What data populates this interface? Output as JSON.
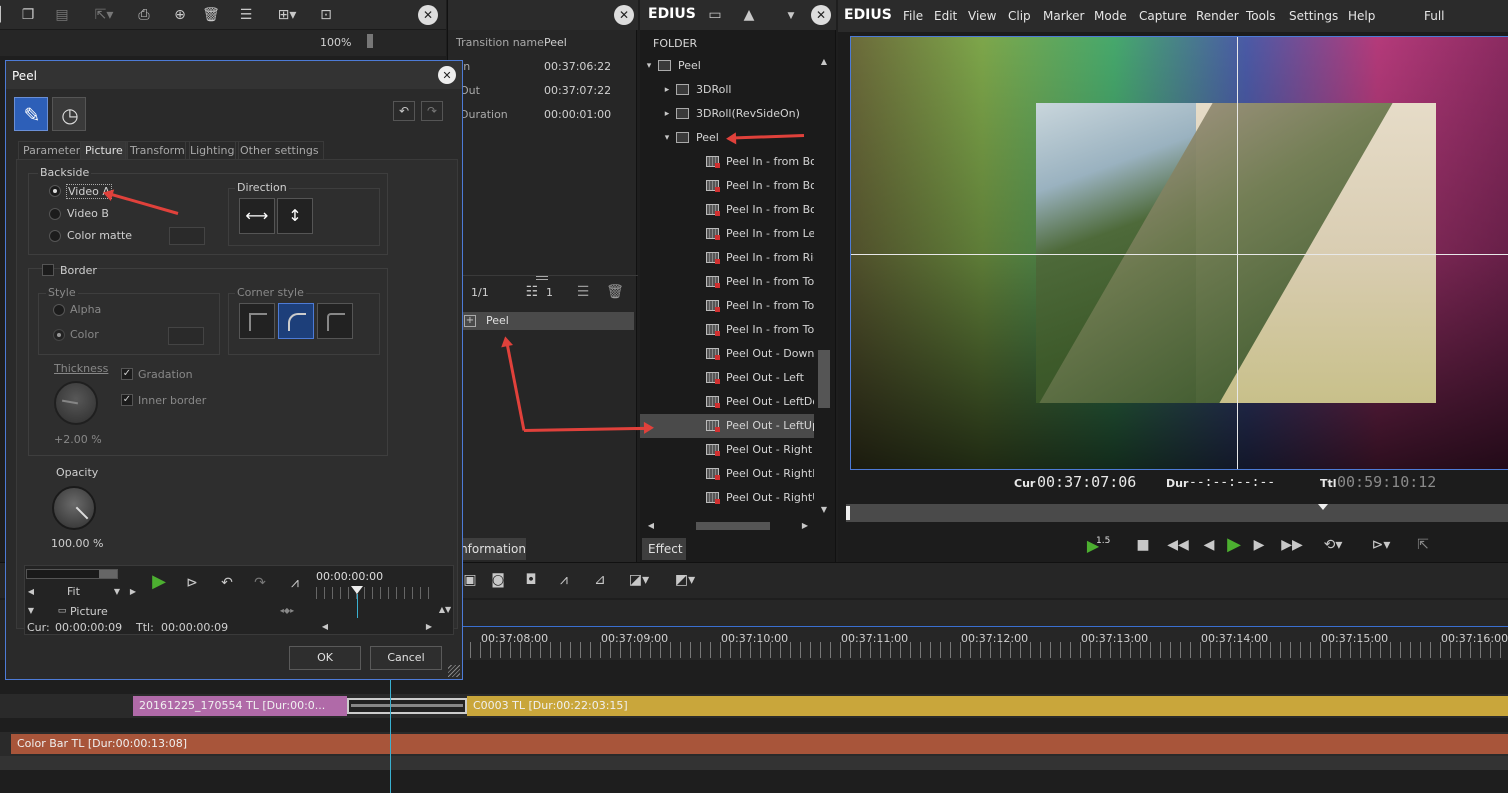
{
  "toolbar": {
    "zoom": "100%"
  },
  "info": {
    "rows": [
      {
        "key": "Transition name",
        "value": "Peel"
      },
      {
        "key": "In",
        "value": "00:37:06:22"
      },
      {
        "key": "Out",
        "value": "00:37:07:22"
      },
      {
        "key": "Duration",
        "value": "00:00:01:00"
      }
    ],
    "page": "1/1",
    "count": "1",
    "list_item": "Peel",
    "tab_label": "Information"
  },
  "effect": {
    "title": "EDIUS",
    "folder_header": "FOLDER",
    "tab_label": "Effect",
    "tree": [
      {
        "label": "Peel",
        "level": 0,
        "type": "folder",
        "expander": "▾"
      },
      {
        "label": "3DRoll",
        "level": 1,
        "type": "group",
        "expander": "▸"
      },
      {
        "label": "3DRoll(RevSideOn)",
        "level": 1,
        "type": "group",
        "expander": "▸"
      },
      {
        "label": "Peel",
        "level": 1,
        "type": "folder",
        "expander": "▾"
      },
      {
        "label": "Peel In - from Bottom",
        "level": 2,
        "type": "fx"
      },
      {
        "label": "Peel In - from Bottom",
        "level": 2,
        "type": "fx"
      },
      {
        "label": "Peel In - from Bottom",
        "level": 2,
        "type": "fx"
      },
      {
        "label": "Peel In - from Left",
        "level": 2,
        "type": "fx"
      },
      {
        "label": "Peel In - from Right",
        "level": 2,
        "type": "fx"
      },
      {
        "label": "Peel In - from Top",
        "level": 2,
        "type": "fx"
      },
      {
        "label": "Peel In - from TopLef",
        "level": 2,
        "type": "fx"
      },
      {
        "label": "Peel In - from TopRig",
        "level": 2,
        "type": "fx"
      },
      {
        "label": "Peel Out - Down",
        "level": 2,
        "type": "fx"
      },
      {
        "label": "Peel Out - Left",
        "level": 2,
        "type": "fx"
      },
      {
        "label": "Peel Out - LeftDown",
        "level": 2,
        "type": "fx"
      },
      {
        "label": "Peel Out - LeftUp",
        "level": 2,
        "type": "fx",
        "selected": true
      },
      {
        "label": "Peel Out - Right",
        "level": 2,
        "type": "fx"
      },
      {
        "label": "Peel Out - RightDown",
        "level": 2,
        "type": "fx"
      },
      {
        "label": "Peel Out - RightUp",
        "level": 2,
        "type": "fx"
      }
    ]
  },
  "preview": {
    "brand": "EDIUS",
    "menu": [
      "File",
      "Edit",
      "View",
      "Clip",
      "Marker",
      "Mode",
      "Capture",
      "Render",
      "Tools",
      "Settings",
      "Help"
    ],
    "view_mode": "Full",
    "cur_label": "Cur",
    "cur": "00:37:07:06",
    "dur_label": "Dur",
    "dur": "--:--:--:--",
    "ttl_label": "Ttl",
    "ttl": "00:59:10:12",
    "speed_badge": "1.5"
  },
  "dialog": {
    "title": "Peel",
    "tabs": [
      "Parameter",
      "Picture",
      "Transform",
      "Lighting",
      "Other settings"
    ],
    "active_tab": "Picture",
    "backside": {
      "label": "Backside",
      "options": [
        "Video A",
        "Video B",
        "Color matte"
      ],
      "selected": "Video A"
    },
    "direction_label": "Direction",
    "border": {
      "label": "Border",
      "style_label": "Style",
      "style_options": [
        "Alpha",
        "Color"
      ],
      "corner_label": "Corner style",
      "thickness_label": "Thickness",
      "thickness_value": "+2.00 %",
      "gradation_label": "Gradation",
      "inner_border_label": "Inner border"
    },
    "opacity": {
      "label": "Opacity",
      "value": "100.00 %"
    },
    "preview": {
      "fit": "Fit",
      "timecode": "00:00:00:00",
      "track_label": "Picture",
      "cur_label": "Cur:",
      "cur": "00:00:00:09",
      "ttl_label": "Ttl:",
      "ttl": "00:00:00:09"
    },
    "ok": "OK",
    "cancel": "Cancel"
  },
  "timeline": {
    "ticks": [
      "00:37:08:00",
      "00:37:09:00",
      "00:37:10:00",
      "00:37:11:00",
      "00:37:12:00",
      "00:37:13:00",
      "00:37:14:00",
      "00:37:15:00",
      "00:37:16:00"
    ],
    "clip_a": "20161225_170554  TL [Dur:00:0...",
    "clip_b": "C0003  TL [Dur:00:22:03:15]",
    "clip_c": "Color Bar  TL [Dur:00:00:13:08]"
  },
  "colors": {
    "accent": "#4d7bd6",
    "annotation_arrow": "#e0413b",
    "clip_yellow": "#c9a63b",
    "clip_pink": "#b06aa8",
    "clip_orange": "#b45a3a"
  }
}
